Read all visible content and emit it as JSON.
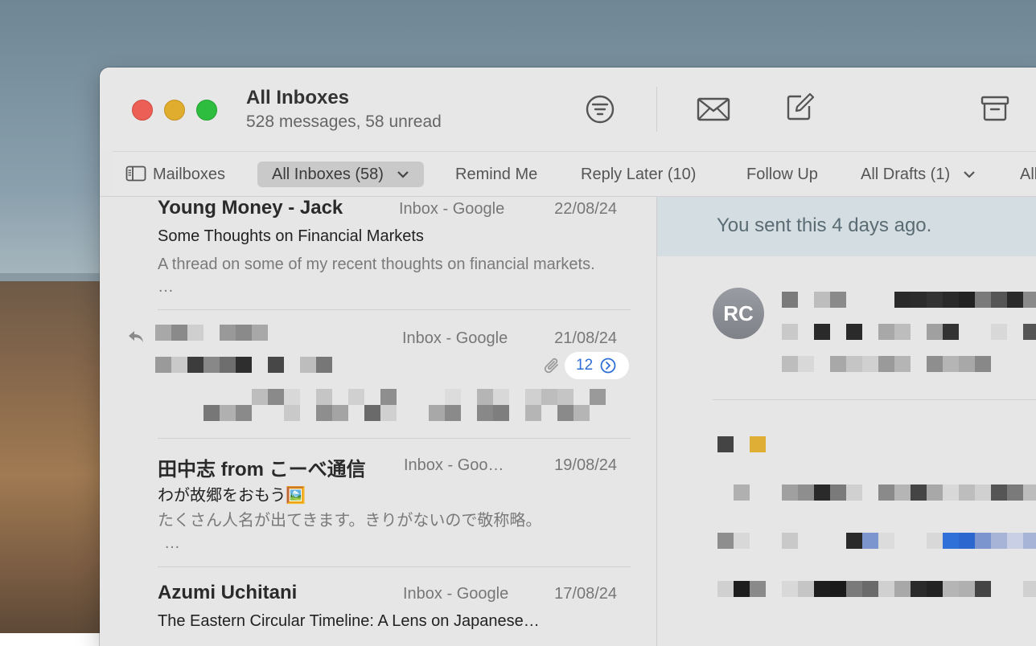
{
  "window": {
    "title": "All Inboxes",
    "subtitle": "528 messages, 58 unread"
  },
  "toolbar": {
    "icons": [
      "filter-icon",
      "get-mail-icon",
      "compose-icon",
      "archive-icon"
    ]
  },
  "favorites": {
    "mailboxes_label": "Mailboxes",
    "items": [
      {
        "label": "All Inboxes (58)",
        "active": true
      },
      {
        "label": "Remind Me"
      },
      {
        "label": "Reply Later (10)"
      },
      {
        "label": "Follow Up"
      },
      {
        "label": "All Drafts (1)"
      },
      {
        "label": "All"
      }
    ]
  },
  "messages": [
    {
      "sender": "Young Money - Jack",
      "mailbox": "Inbox - Google",
      "date": "22/08/24",
      "subject": "Some Thoughts on Financial Markets",
      "preview": "A thread on some of my recent thoughts on financial markets. …"
    },
    {
      "sender": "",
      "mailbox": "Inbox - Google",
      "date": "21/08/24",
      "thread_count": "12",
      "replied": true,
      "has_attachment": true
    },
    {
      "sender": "田中志 from こーべ通信",
      "mailbox": "Inbox - Goo…",
      "date": "19/08/24",
      "subject": "わが故郷をおもう🖼️",
      "preview": "たくさん人名が出てきます。きりがないので敬称略。",
      "preview_more": "…"
    },
    {
      "sender": "Azumi Uchitani",
      "mailbox": "Inbox - Google",
      "date": "17/08/24",
      "subject": "The Eastern Circular Timeline: A Lens on Japanese…"
    }
  ],
  "reader": {
    "banner": "You sent this 4 days ago.",
    "avatar_initials": "RC"
  },
  "colors": {
    "accent_blue": "#2f6fd8",
    "close": "#ec5f56",
    "minimize": "#e0ad2f",
    "zoom": "#2fbd3f"
  }
}
